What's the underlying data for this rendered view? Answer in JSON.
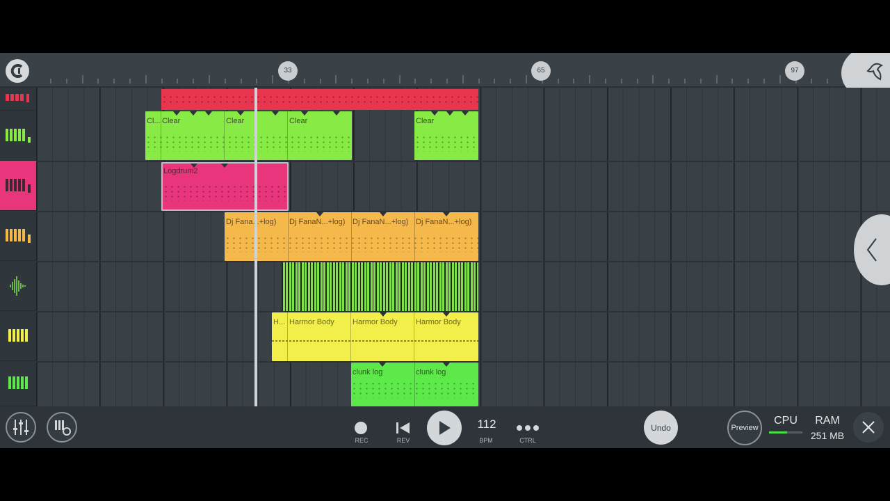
{
  "ruler": {
    "markers": [
      "33",
      "65",
      "97"
    ]
  },
  "tracks": [
    {
      "name": "track-1",
      "icon": "piano-roll-icon",
      "color": "#e8364f"
    },
    {
      "name": "track-2",
      "icon": "piano-roll-icon",
      "color": "#87ea45"
    },
    {
      "name": "track-3",
      "icon": "piano-roll-icon",
      "color": "#e8357b",
      "selected": true
    },
    {
      "name": "track-4",
      "icon": "piano-roll-icon",
      "color": "#f5b84a"
    },
    {
      "name": "track-5",
      "icon": "waveform-icon",
      "color": "#7fe04a"
    },
    {
      "name": "track-6",
      "icon": "piano-roll-icon",
      "color": "#f2ef4a"
    },
    {
      "name": "track-7",
      "icon": "piano-roll-icon",
      "color": "#5ee94a"
    }
  ],
  "clips": {
    "track2": [
      "Cl...",
      "Clear",
      "Clear",
      "Clear",
      "Clear"
    ],
    "track3": [
      "Logdrum2"
    ],
    "track4": [
      "Dj Fana...+log)",
      "Dj FanaN...+log)",
      "Dj FanaN...+log)",
      "Dj FanaN...+log)"
    ],
    "track6": [
      "H...",
      "Harmor Body",
      "Harmor Body",
      "Harmor Body"
    ],
    "track7": [
      "clunk log",
      "clunk log"
    ]
  },
  "transport": {
    "rec_label": "REC",
    "rev_label": "REV",
    "tempo_value": "112",
    "tempo_label": "BPM",
    "ctrl_label": "CTRL",
    "undo_label": "Undo",
    "preview_label": "Preview",
    "cpu_label": "CPU",
    "ram_label": "RAM",
    "ram_value": "251 MB",
    "cpu_level": 0.55
  },
  "colors": {
    "red": "#e8364f",
    "green": "#87ea45",
    "pink": "#e8357b",
    "orange": "#f5b84a",
    "yellow": "#f2ef4a",
    "lime": "#5ee94a"
  }
}
